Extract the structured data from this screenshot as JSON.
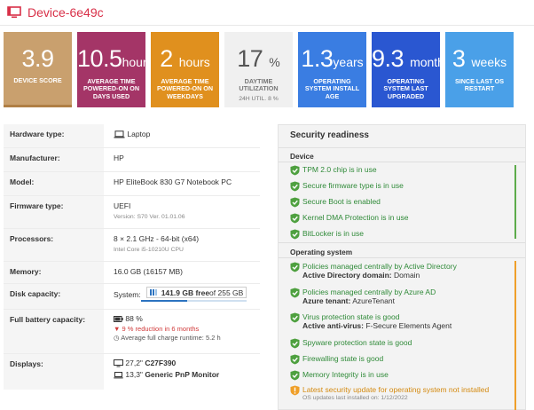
{
  "header": {
    "title": "Device-6e49c",
    "icon": "device-icon",
    "accent": "#d83048"
  },
  "tiles": [
    {
      "value": "3.9",
      "unit": "",
      "label": "DEVICE SCORE",
      "color": "#c9a06e"
    },
    {
      "value": "10.5",
      "unit": "hours",
      "label": "AVERAGE TIME POWERED-ON ON DAYS USED",
      "color": "#a43567"
    },
    {
      "value": "2",
      "unit": "hours",
      "label": "AVERAGE TIME POWERED-ON ON WEEKDAYS",
      "color": "#e0901e"
    },
    {
      "value": "17",
      "unit": "%",
      "label": "DAYTIME UTILIZATION",
      "sub": "24H UTIL. 8 %",
      "color": "#f0f0f0"
    },
    {
      "value": "1.3",
      "unit": "years",
      "label": "OPERATING SYSTEM INSTALL AGE",
      "color": "#3a7de2"
    },
    {
      "value": "9.3",
      "unit": "months",
      "label": "OPERATING SYSTEM LAST UPGRADED",
      "color": "#2a57d1"
    },
    {
      "value": "3",
      "unit": "weeks",
      "label": "SINCE LAST OS RESTART",
      "color": "#4aa0e8"
    }
  ],
  "hardware": {
    "hardware_type": {
      "label": "Hardware type:",
      "value": "Laptop",
      "icon": "laptop-icon"
    },
    "manufacturer": {
      "label": "Manufacturer:",
      "value": "HP"
    },
    "model": {
      "label": "Model:",
      "value": "HP EliteBook 830 G7 Notebook PC"
    },
    "firmware": {
      "label": "Firmware type:",
      "value": "UEFI",
      "detail": "Version: S70 Ver. 01.01.06"
    },
    "processors": {
      "label": "Processors:",
      "value": "8 × 2.1 GHz - 64-bit (x64)",
      "detail": "Intel Core i5-10210U CPU"
    },
    "memory": {
      "label": "Memory:",
      "value": "16.0 GB (16157 MB)"
    },
    "disk": {
      "label": "Disk capacity:",
      "prefix": "System:",
      "free": "141.9 GB free",
      "total": " of 255 GB",
      "used_fraction": 0.44
    },
    "battery": {
      "label": "Full battery capacity:",
      "value": "88 %",
      "reduction": "9 % reduction in 6 months",
      "runtime": "Average full charge runtime: 5.2 h"
    },
    "displays": {
      "label": "Displays:",
      "d1_size": "27,2\"",
      "d1_name": "C27F390",
      "d2_size": "13,3\"",
      "d2_name": "Generic PnP Monitor"
    }
  },
  "security": {
    "title": "Security readiness",
    "device_section": "Device",
    "device_items": [
      "TPM 2.0 chip is in use",
      "Secure firmware type is in use",
      "Secure Boot is enabled",
      "Kernel DMA Protection is in use",
      "BitLocker is in use"
    ],
    "os_section": "Operating system",
    "os_items": {
      "policies_ad": "Policies managed centrally by Active Directory",
      "ad_domain_label": "Active Directory domain:",
      "ad_domain_value": "Domain",
      "policies_azure": "Policies managed centrally by Azure AD",
      "azure_tenant_label": "Azure tenant:",
      "azure_tenant_value": "AzureTenant",
      "virus": "Virus protection state is good",
      "antivirus_label": "Active anti-virus:",
      "antivirus_value": "F-Secure Elements Agent",
      "spyware": "Spyware protection state is good",
      "firewall": "Firewalling state is good",
      "memory_integrity": "Memory Integrity is in use",
      "latest_update": "Latest security update for operating system not installed",
      "updates_note": "OS updates last installed on: 1/12/2022"
    },
    "colors": {
      "good": "#2f8a38",
      "warning": "#d48a10"
    }
  }
}
